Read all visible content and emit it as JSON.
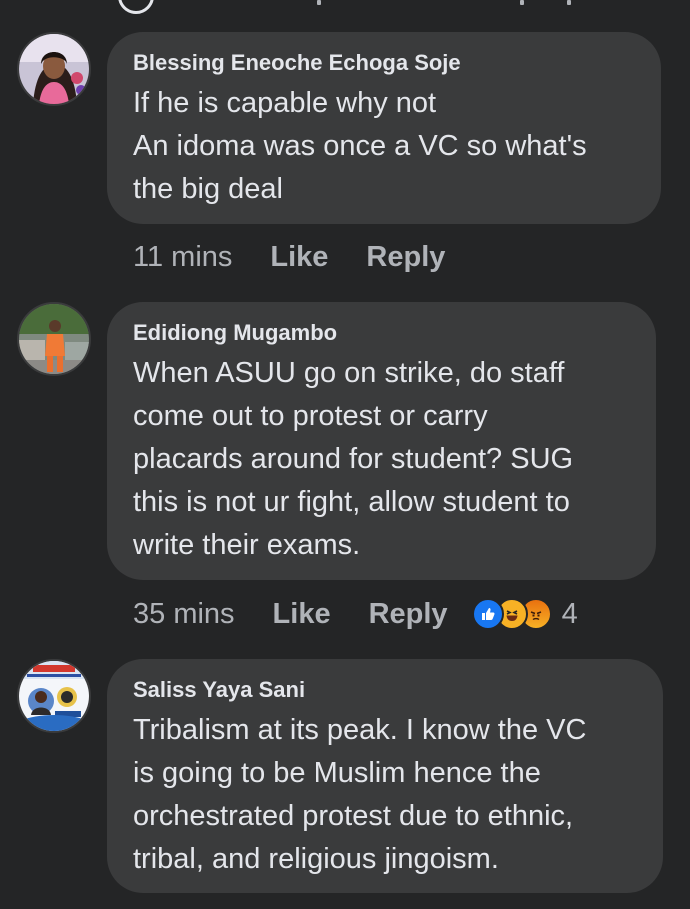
{
  "comments": [
    {
      "author": "Blessing Eneoche Echoga Soje",
      "lines": [
        "If he is capable why not",
        "An idoma was once a VC so what's",
        "the big deal"
      ],
      "time": "11 mins",
      "like_label": "Like",
      "reply_label": "Reply"
    },
    {
      "author": "Edidiong Mugambo",
      "lines": [
        "When ASUU go on strike, do staff",
        "come out to protest or carry",
        "placards around for student? SUG",
        "this is not ur fight, allow student to",
        "write their exams."
      ],
      "time": "35 mins",
      "like_label": "Like",
      "reply_label": "Reply",
      "reaction_count": "4",
      "reaction_icons": [
        "like-reaction",
        "haha-reaction",
        "angry-reaction"
      ]
    },
    {
      "author": "Saliss Yaya Sani",
      "lines": [
        "Tribalism at its peak. I know the VC",
        "is going to be Muslim hence the",
        "orchestrated protest due to ethnic,",
        "tribal, and religious jingoism."
      ]
    }
  ],
  "colors": {
    "background": "#242526",
    "bubble": "#3a3b3c",
    "text": "#e4e6eb",
    "secondary_text": "#b0b3b8",
    "like_blue": "#1877f2"
  }
}
